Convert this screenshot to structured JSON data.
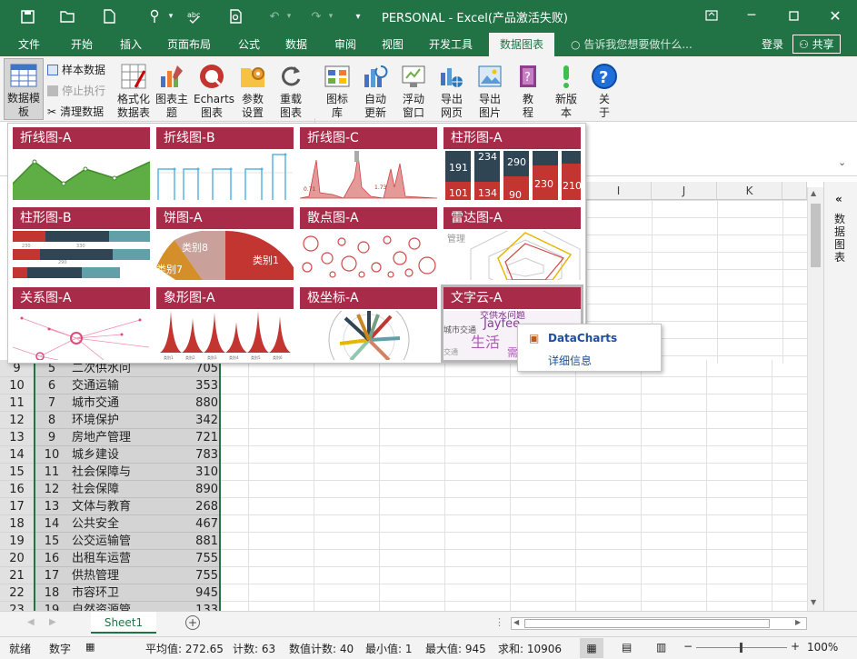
{
  "window": {
    "title": "PERSONAL - Excel(产品激活失败)",
    "accent": "#217346"
  },
  "quick_access": [
    "save-icon",
    "open-icon",
    "new-icon",
    "touch-icon",
    "spellcheck-icon",
    "preview-icon",
    "undo-icon",
    "redo-icon",
    "customize-icon"
  ],
  "tabs": {
    "file": "文件",
    "home": "开始",
    "insert": "插入",
    "layout": "页面布局",
    "formula": "公式",
    "data": "数据",
    "review": "审阅",
    "view": "视图",
    "developer": "开发工具",
    "charts": "数据图表",
    "tellme": "告诉我您想要做什么...",
    "login": "登录",
    "share": "共享"
  },
  "ribbon": {
    "template_btn": "数据模板",
    "sample_data": "样本数据",
    "stop_exec": "停止执行",
    "clear_data": "清理数据",
    "format_table": "格式化数据表",
    "chart_theme": "图表主题",
    "echarts": "Echarts图表",
    "params": "参数设置",
    "redraw": "重载图表",
    "chart_lib": "图标库",
    "auto_update": "自动更新",
    "float_window": "浮动窗口",
    "export_web": "导出网页",
    "export_img": "导出图片",
    "tutorial": "教程",
    "new_version": "新版本",
    "about": "关于"
  },
  "gallery": {
    "items": [
      {
        "label": "折线图-A"
      },
      {
        "label": "折线图-B"
      },
      {
        "label": "折线图-C",
        "ticks": [
          "0.71",
          "1.73"
        ]
      },
      {
        "label": "柱形图-A",
        "values": [
          "191",
          "234",
          "290",
          "101",
          "134",
          "90",
          "230",
          "210"
        ]
      },
      {
        "label": "柱形图-B",
        "ticks": [
          "230",
          "330",
          "290"
        ]
      },
      {
        "label": "饼图-A",
        "slices": [
          "类别8",
          "类别7",
          "类别1"
        ]
      },
      {
        "label": "散点图-A"
      },
      {
        "label": "雷达图-A",
        "axis": "管理"
      },
      {
        "label": "关系图-A"
      },
      {
        "label": "象形图-A",
        "cats": [
          "类别1",
          "类别2",
          "类别3",
          "类别4",
          "类别5",
          "类别6"
        ]
      },
      {
        "label": "极坐标-A"
      },
      {
        "label": "文字云-A",
        "words": [
          "Jayfee",
          "城市交通",
          "交供水问题"
        ]
      }
    ]
  },
  "context_menu": {
    "title": "DataCharts",
    "detail": "详细信息"
  },
  "columns": [
    "I",
    "J",
    "K"
  ],
  "rows": [
    {
      "n": "9",
      "a": "5",
      "b": "二次供水问",
      "c": "705"
    },
    {
      "n": "10",
      "a": "6",
      "b": "交通运输",
      "c": "353"
    },
    {
      "n": "11",
      "a": "7",
      "b": "城市交通",
      "c": "880"
    },
    {
      "n": "12",
      "a": "8",
      "b": "环境保护",
      "c": "342"
    },
    {
      "n": "13",
      "a": "9",
      "b": "房地产管理",
      "c": "721"
    },
    {
      "n": "14",
      "a": "10",
      "b": "城乡建设",
      "c": "783"
    },
    {
      "n": "15",
      "a": "11",
      "b": "社会保障与",
      "c": "310"
    },
    {
      "n": "16",
      "a": "12",
      "b": "社会保障",
      "c": "890"
    },
    {
      "n": "17",
      "a": "13",
      "b": "文体与教育",
      "c": "268"
    },
    {
      "n": "18",
      "a": "14",
      "b": "公共安全",
      "c": "467"
    },
    {
      "n": "19",
      "a": "15",
      "b": "公交运输管",
      "c": "881"
    },
    {
      "n": "20",
      "a": "16",
      "b": "出租车运营",
      "c": "755"
    },
    {
      "n": "21",
      "a": "17",
      "b": "供热管理",
      "c": "755"
    },
    {
      "n": "22",
      "a": "18",
      "b": "市容环卫",
      "c": "945"
    },
    {
      "n": "23",
      "a": "19",
      "b": "自然资源管",
      "c": "133"
    }
  ],
  "sidepane": {
    "label": "数据图表"
  },
  "sheet": {
    "name": "Sheet1"
  },
  "status": {
    "ready": "就绪",
    "mode": "数字",
    "average": "平均值: 272.65",
    "count": "计数: 63",
    "num_count": "数值计数: 40",
    "min": "最小值: 1",
    "max": "最大值: 945",
    "sum": "求和: 10906",
    "zoom": "100%"
  }
}
